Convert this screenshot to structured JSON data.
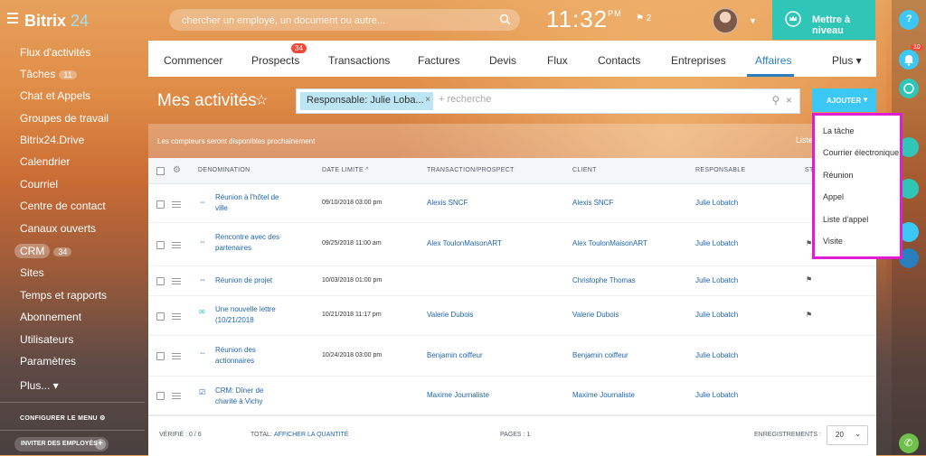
{
  "app": {
    "name": "Bitrix",
    "version": "24"
  },
  "search": {
    "placeholder": "chercher un employé, un document ou autre..."
  },
  "clock": {
    "time": "11:32",
    "ampm": "PM"
  },
  "flag_count": "2",
  "upgrade_label": "Mettre à niveau",
  "rail": {
    "notification_count": "10"
  },
  "left_menu": {
    "items": [
      {
        "label": "Flux d'activités"
      },
      {
        "label": "Tâches",
        "count": "11"
      },
      {
        "label": "Chat et Appels"
      },
      {
        "label": "Groupes de travail"
      },
      {
        "label": "Bitrix24.Drive"
      },
      {
        "label": "Calendrier"
      },
      {
        "label": "Courriel"
      },
      {
        "label": "Centre de contact"
      },
      {
        "label": "Canaux ouverts"
      },
      {
        "label": "CRM",
        "count": "34"
      },
      {
        "label": "Sites"
      },
      {
        "label": "Temps et rapports"
      },
      {
        "label": "Abonnement"
      },
      {
        "label": "Utilisateurs"
      },
      {
        "label": "Paramètres"
      },
      {
        "label": "Plus... ▾"
      }
    ],
    "configure_label": "CONFIGURER LE MENU",
    "invite_label": "INVITER DES EMPLOYÉS"
  },
  "tabs": [
    {
      "label": "Commencer"
    },
    {
      "label": "Prospects",
      "badge": "34"
    },
    {
      "label": "Transactions"
    },
    {
      "label": "Factures"
    },
    {
      "label": "Devis"
    },
    {
      "label": "Flux"
    },
    {
      "label": "Contacts"
    },
    {
      "label": "Entreprises"
    },
    {
      "label": "Affaires"
    },
    {
      "label": "Plus ▾"
    }
  ],
  "page": {
    "title": "Mes activités",
    "filter_chip": "Responsable: Julie Loba...",
    "filter_placeholder": "+ recherche",
    "add_button": "AJOUTER",
    "notice": "Les compteurs seront disponibles prochainement",
    "list_link": "Liste"
  },
  "grid": {
    "columns": [
      "DENOMINATION",
      "DATE LIMITE ^",
      "TRANSACTION/PROSPECT",
      "CLIENT",
      "RESPONSABLE",
      "ST"
    ],
    "rows": [
      {
        "name_l1": "Réunion à l'hôtel de",
        "name_l2": "ville",
        "icon": "meeting-icon",
        "date": "09/10/2018 03:00 pm",
        "transaction": "Alexis SNCF",
        "client": "Alexis SNCF",
        "responsible": "Julie Lobatch",
        "flag": ""
      },
      {
        "name_l1": "Rencontre avec des",
        "name_l2": "partenaires",
        "icon": "meeting-icon",
        "date": "09/25/2018 11:00 am",
        "transaction": "Alex ToulonMaisonART",
        "client": "Alex ToulonMaisonART",
        "responsible": "Julie Lobatch",
        "flag": "⚑"
      },
      {
        "name_l1": "Réunion de projet",
        "name_l2": "",
        "icon": "meeting-icon",
        "date": "10/03/2018 01:00 pm",
        "transaction": "",
        "client": "Christophe Thomas",
        "responsible": "Julie Lobatch",
        "flag": "⚑"
      },
      {
        "name_l1": "Une nouvelle lettre",
        "name_l2": "(10/21/2018",
        "icon": "mail-icon",
        "date": "10/21/2018 11:17 pm",
        "transaction": "Valerie Dubois",
        "client": "Valerie Dubois",
        "responsible": "Julie Lobatch",
        "flag": "⚑"
      },
      {
        "name_l1": "Réunion des",
        "name_l2": "actionnaires",
        "icon": "meeting-icon",
        "date": "10/24/2018 03:00 pm",
        "transaction": "Benjamin coiffeur",
        "client": "Benjamin coiffeur",
        "responsible": "Julie Lobatch",
        "flag": ""
      },
      {
        "name_l1": "CRM: Dîner de",
        "name_l2": "charité à Vichy",
        "icon": "task-icon",
        "date": "",
        "transaction": "Maxime Journaliste",
        "client": "Maxime Journaliste",
        "responsible": "Julie Lobatch",
        "flag": ""
      }
    ],
    "footer": {
      "verified": "VÉRIFIÉ : 0 / 6",
      "total_label": "TOTAL:",
      "total_link": "AFFICHER LA QUANTITÉ",
      "pages": "PAGES : 1",
      "records_label": "ENREGISTREMENTS :",
      "per_page": "20"
    }
  },
  "add_menu": {
    "items": [
      {
        "label": "La tâche"
      },
      {
        "label": "Courrier électronique"
      },
      {
        "label": "Réunion"
      },
      {
        "label": "Appel"
      },
      {
        "label": "Liste d'appel"
      },
      {
        "label": "Visite"
      }
    ]
  },
  "colors": {
    "accent": "#2b7ebd",
    "add_button": "#3bc8f5",
    "upgrade": "#2fc6b8",
    "highlight_border": "#e01cd5",
    "badge": "#ef4b3a"
  }
}
